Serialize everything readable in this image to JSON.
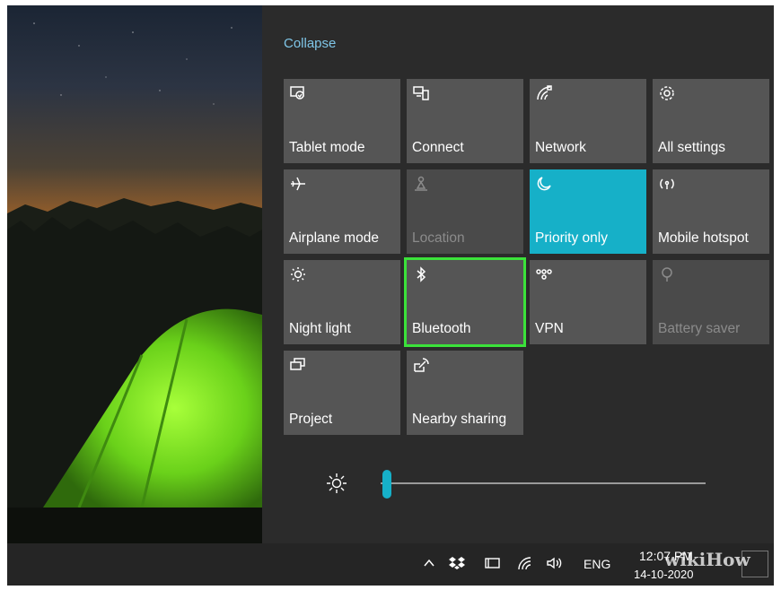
{
  "panel": {
    "collapse_label": "Collapse",
    "tiles": [
      {
        "label": "Tablet mode",
        "icon": "tablet-mode-icon",
        "state": "normal"
      },
      {
        "label": "Connect",
        "icon": "connect-icon",
        "state": "normal"
      },
      {
        "label": "Network",
        "icon": "network-icon",
        "state": "normal"
      },
      {
        "label": "All settings",
        "icon": "gear-icon",
        "state": "normal"
      },
      {
        "label": "Airplane mode",
        "icon": "airplane-icon",
        "state": "normal"
      },
      {
        "label": "Location",
        "icon": "location-icon",
        "state": "disabled"
      },
      {
        "label": "Priority only",
        "icon": "moon-icon",
        "state": "active"
      },
      {
        "label": "Mobile hotspot",
        "icon": "hotspot-icon",
        "state": "normal"
      },
      {
        "label": "Night light",
        "icon": "night-light-icon",
        "state": "normal"
      },
      {
        "label": "Bluetooth",
        "icon": "bluetooth-icon",
        "state": "highlighted"
      },
      {
        "label": "VPN",
        "icon": "vpn-icon",
        "state": "normal"
      },
      {
        "label": "Battery saver",
        "icon": "battery-saver-icon",
        "state": "disabled"
      },
      {
        "label": "Project",
        "icon": "project-icon",
        "state": "normal"
      },
      {
        "label": "Nearby sharing",
        "icon": "nearby-sharing-icon",
        "state": "normal"
      }
    ],
    "brightness": {
      "icon": "brightness-icon",
      "level": 0.02
    }
  },
  "taskbar": {
    "lang": "ENG",
    "time": "12:07 PM",
    "date": "14-10-2020"
  },
  "watermark": "wikiHow",
  "colors": {
    "accent": "#16b0c8",
    "highlight": "#3be23a",
    "tile": "#555555",
    "panel": "#2b2b2b"
  }
}
